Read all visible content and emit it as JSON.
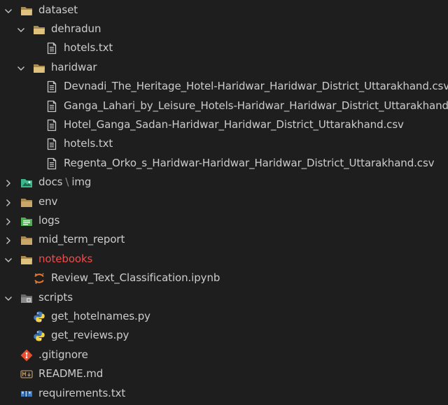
{
  "explorer": {
    "items": [
      {
        "label": "dataset",
        "kind": "folder-open",
        "level": 0,
        "chevron": "down"
      },
      {
        "label": "dehradun",
        "kind": "folder-open",
        "level": 1,
        "chevron": "down"
      },
      {
        "label": "hotels.txt",
        "kind": "file-text",
        "level": 2
      },
      {
        "label": "haridwar",
        "kind": "folder-open",
        "level": 1,
        "chevron": "down"
      },
      {
        "label": "Devnadi_The_Heritage_Hotel-Haridwar_Haridwar_District_Uttarakhand.csv",
        "kind": "file-text",
        "level": 2
      },
      {
        "label": "Ganga_Lahari_by_Leisure_Hotels-Haridwar_Haridwar_District_Uttarakhand.csv",
        "kind": "file-text",
        "level": 2
      },
      {
        "label": "Hotel_Ganga_Sadan-Haridwar_Haridwar_District_Uttarakhand.csv",
        "kind": "file-text",
        "level": 2
      },
      {
        "label": "hotels.txt",
        "kind": "file-text",
        "level": 2
      },
      {
        "label": "Regenta_Orko_s_Haridwar-Haridwar_Haridwar_District_Uttarakhand.csv",
        "kind": "file-text",
        "level": 2
      },
      {
        "label": "docs",
        "label_suffix": "img",
        "separator": "\\",
        "kind": "folder-images",
        "level": 0,
        "chevron": "right"
      },
      {
        "label": "env",
        "kind": "folder",
        "level": 0,
        "chevron": "right"
      },
      {
        "label": "logs",
        "kind": "folder-logs",
        "level": 0,
        "chevron": "right"
      },
      {
        "label": "mid_term_report",
        "kind": "folder",
        "level": 0,
        "chevron": "right"
      },
      {
        "label": "notebooks",
        "kind": "folder-open",
        "level": 0,
        "chevron": "down",
        "highlight": true
      },
      {
        "label": "Review_Text_Classification.ipynb",
        "kind": "jupyter",
        "level": 1
      },
      {
        "label": "scripts",
        "kind": "folder-scripts",
        "level": 0,
        "chevron": "down"
      },
      {
        "label": "get_hotelnames.py",
        "kind": "python",
        "level": 1
      },
      {
        "label": "get_reviews.py",
        "kind": "python",
        "level": 1
      },
      {
        "label": ".gitignore",
        "kind": "git",
        "level": 0
      },
      {
        "label": "README.md",
        "kind": "markdown",
        "level": 0
      },
      {
        "label": "requirements.txt",
        "kind": "pip",
        "level": 0
      }
    ]
  },
  "colors": {
    "background": "#1e1e1e",
    "text": "#cccccc",
    "highlight_text": "#f14c4c",
    "folder": "#c9a86a",
    "images_folder": "#3fb68b",
    "logs_folder": "#4caf50",
    "python_blue": "#3f7cbf",
    "python_yellow": "#f5d547",
    "git": "#e84e31",
    "jupyter": "#f37726"
  }
}
